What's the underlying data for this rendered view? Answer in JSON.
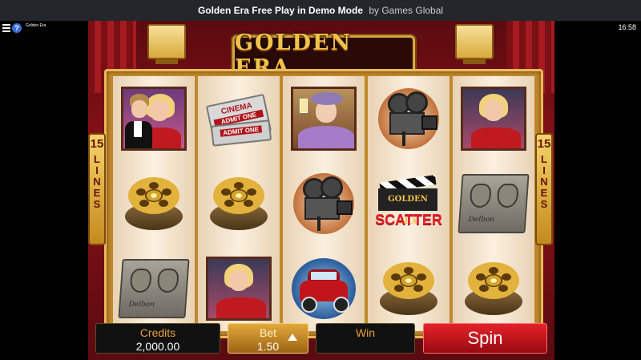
{
  "topbar": {
    "title": "Golden Era Free Play in Demo Mode",
    "by": "by Games Global"
  },
  "status": {
    "small_label": "Golden Era",
    "time": "16:58",
    "help_glyph": "?"
  },
  "game": {
    "logo": "GOLDEN ERA",
    "lines_count": "15",
    "lines_word": [
      "L",
      "I",
      "N",
      "E",
      "S"
    ],
    "reels": [
      [
        "couple",
        "tickets",
        "film-reel"
      ],
      [
        "film-reel",
        "film-reel",
        "actress"
      ],
      [
        "granny",
        "camera",
        "car"
      ],
      [
        "camera",
        "scatter",
        "film-reel"
      ],
      [
        "actress",
        "hand-prints",
        "film-reel"
      ]
    ],
    "tickets": {
      "title": "CINEMA",
      "admit": "ADMIT ONE"
    },
    "scatter": {
      "board": "GOLDEN ERA",
      "label": "SCATTER"
    },
    "signature": "Delbon"
  },
  "controls": {
    "credits_label": "Credits",
    "credits_value": "2,000.00",
    "bet_label": "Bet",
    "bet_value": "1.50",
    "win_label": "Win",
    "win_value": "",
    "spin_label": "Spin"
  },
  "colors": {
    "gold": "#f1c24a",
    "spin_red": "#e3222a",
    "label_orange": "#e8a03a"
  }
}
